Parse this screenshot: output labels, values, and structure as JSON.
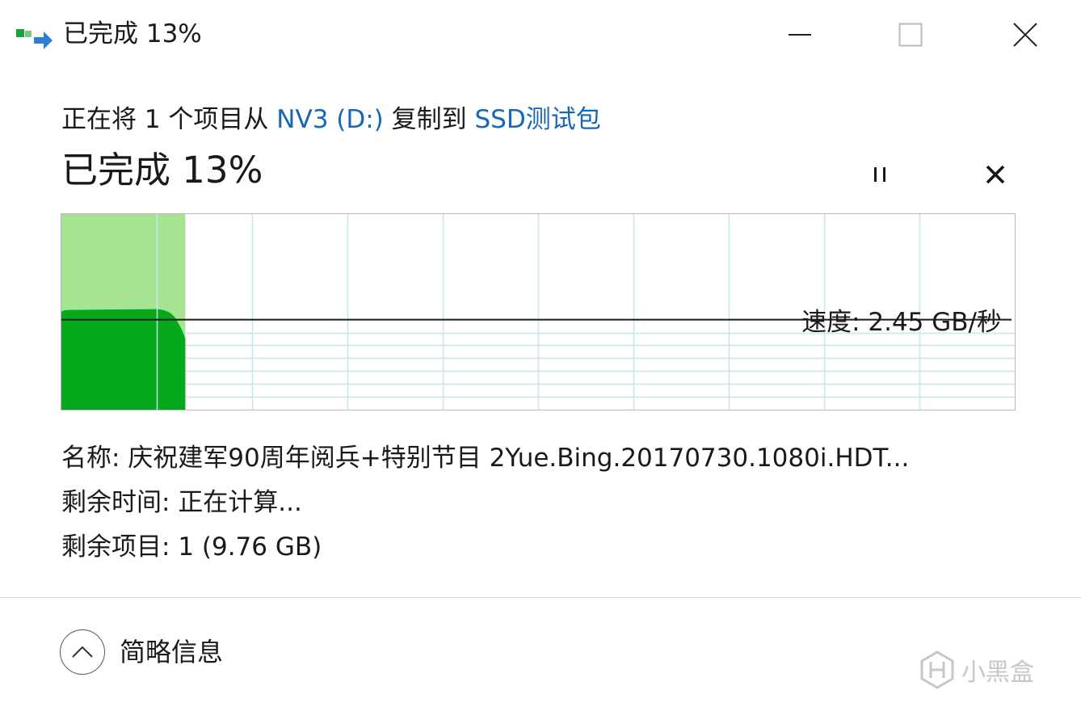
{
  "window": {
    "title": "已完成 13%",
    "icon": "file-copy-icon",
    "controls": [
      "minimize-icon",
      "maximize-icon",
      "close-icon"
    ]
  },
  "copy": {
    "prefix": "正在将 1 个项目从 ",
    "source": "NV3 (D:)",
    "middle": " 复制到 ",
    "destination": "SSD测试包"
  },
  "progress": {
    "title": "已完成 13%",
    "percent": 13,
    "pause_icon": "pause-icon",
    "cancel_icon": "cancel-icon"
  },
  "graph": {
    "speed_text": "速度: 2.45 GB/秒",
    "speed_level": 0.46,
    "colors": {
      "done": "#a6e494",
      "speed": "#06a91e",
      "grid": "#c8e6ee",
      "line": "#1a1a1a"
    }
  },
  "details": {
    "name_label": "名称: ",
    "name_value": "庆祝建军90周年阅兵+特别节目 2Yue.Bing.20170730.1080i.HDT...",
    "time_label": "剩余时间: ",
    "time_value": "正在计算...",
    "items_label": "剩余项目: ",
    "items_value": "1 (9.76 GB)"
  },
  "footer": {
    "toggle_icon": "chevron-up-icon",
    "toggle_label": "简略信息"
  },
  "watermark": {
    "text": "小黑盒"
  }
}
